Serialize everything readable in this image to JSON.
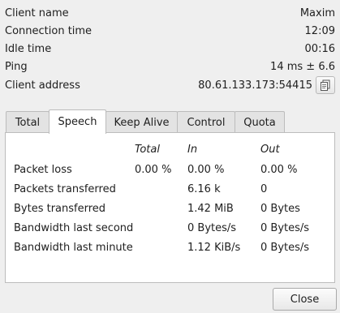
{
  "info": {
    "client_name": {
      "label": "Client name",
      "value": "Maxim"
    },
    "connection_time": {
      "label": "Connection time",
      "value": "12:09"
    },
    "idle_time": {
      "label": "Idle time",
      "value": "00:16"
    },
    "ping": {
      "label": "Ping",
      "value": "14 ms ± 6.6"
    },
    "client_address": {
      "label": "Client address",
      "value": "80.61.133.173:54415",
      "copy_icon": "copy-icon"
    }
  },
  "tabs": [
    {
      "label": "Total",
      "active": false
    },
    {
      "label": "Speech",
      "active": true
    },
    {
      "label": "Keep Alive",
      "active": false
    },
    {
      "label": "Control",
      "active": false
    },
    {
      "label": "Quota",
      "active": false
    }
  ],
  "table": {
    "columns": [
      "Total",
      "In",
      "Out"
    ],
    "rows": [
      {
        "label": "Packet loss",
        "total": "0.00 %",
        "in": "0.00 %",
        "out": "0.00 %"
      },
      {
        "label": "Packets transferred",
        "total": "",
        "in": "6.16 k",
        "out": "0"
      },
      {
        "label": "Bytes transferred",
        "total": "",
        "in": "1.42 MiB",
        "out": "0 Bytes"
      },
      {
        "label": "Bandwidth last second",
        "total": "",
        "in": "0 Bytes/s",
        "out": "0 Bytes/s"
      },
      {
        "label": "Bandwidth last minute",
        "total": "",
        "in": "1.12 KiB/s",
        "out": "0 Bytes/s"
      }
    ]
  },
  "close_label": "Close"
}
